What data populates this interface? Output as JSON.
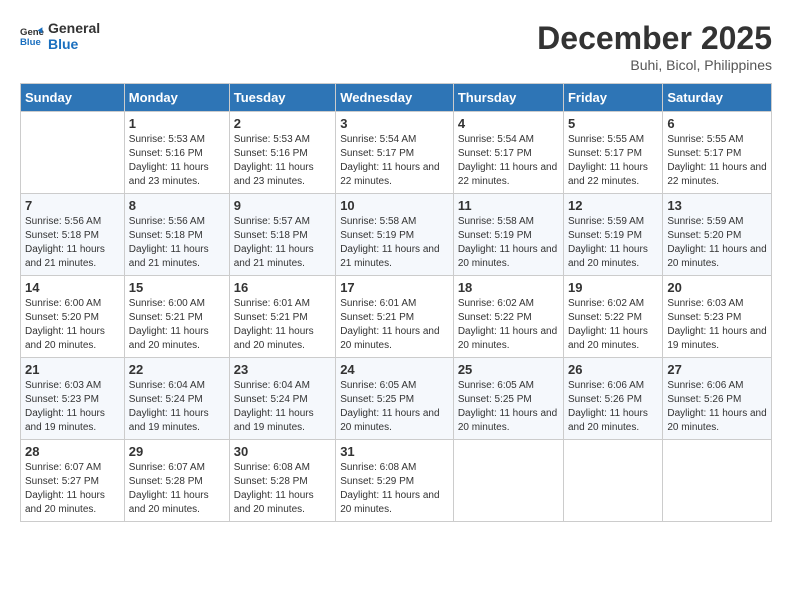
{
  "header": {
    "logo_line1": "General",
    "logo_line2": "Blue",
    "month": "December 2025",
    "location": "Buhi, Bicol, Philippines"
  },
  "weekdays": [
    "Sunday",
    "Monday",
    "Tuesday",
    "Wednesday",
    "Thursday",
    "Friday",
    "Saturday"
  ],
  "weeks": [
    [
      {
        "day": "",
        "sunrise": "",
        "sunset": "",
        "daylight": ""
      },
      {
        "day": "1",
        "sunrise": "Sunrise: 5:53 AM",
        "sunset": "Sunset: 5:16 PM",
        "daylight": "Daylight: 11 hours and 23 minutes."
      },
      {
        "day": "2",
        "sunrise": "Sunrise: 5:53 AM",
        "sunset": "Sunset: 5:16 PM",
        "daylight": "Daylight: 11 hours and 23 minutes."
      },
      {
        "day": "3",
        "sunrise": "Sunrise: 5:54 AM",
        "sunset": "Sunset: 5:17 PM",
        "daylight": "Daylight: 11 hours and 22 minutes."
      },
      {
        "day": "4",
        "sunrise": "Sunrise: 5:54 AM",
        "sunset": "Sunset: 5:17 PM",
        "daylight": "Daylight: 11 hours and 22 minutes."
      },
      {
        "day": "5",
        "sunrise": "Sunrise: 5:55 AM",
        "sunset": "Sunset: 5:17 PM",
        "daylight": "Daylight: 11 hours and 22 minutes."
      },
      {
        "day": "6",
        "sunrise": "Sunrise: 5:55 AM",
        "sunset": "Sunset: 5:17 PM",
        "daylight": "Daylight: 11 hours and 22 minutes."
      }
    ],
    [
      {
        "day": "7",
        "sunrise": "Sunrise: 5:56 AM",
        "sunset": "Sunset: 5:18 PM",
        "daylight": "Daylight: 11 hours and 21 minutes."
      },
      {
        "day": "8",
        "sunrise": "Sunrise: 5:56 AM",
        "sunset": "Sunset: 5:18 PM",
        "daylight": "Daylight: 11 hours and 21 minutes."
      },
      {
        "day": "9",
        "sunrise": "Sunrise: 5:57 AM",
        "sunset": "Sunset: 5:18 PM",
        "daylight": "Daylight: 11 hours and 21 minutes."
      },
      {
        "day": "10",
        "sunrise": "Sunrise: 5:58 AM",
        "sunset": "Sunset: 5:19 PM",
        "daylight": "Daylight: 11 hours and 21 minutes."
      },
      {
        "day": "11",
        "sunrise": "Sunrise: 5:58 AM",
        "sunset": "Sunset: 5:19 PM",
        "daylight": "Daylight: 11 hours and 20 minutes."
      },
      {
        "day": "12",
        "sunrise": "Sunrise: 5:59 AM",
        "sunset": "Sunset: 5:19 PM",
        "daylight": "Daylight: 11 hours and 20 minutes."
      },
      {
        "day": "13",
        "sunrise": "Sunrise: 5:59 AM",
        "sunset": "Sunset: 5:20 PM",
        "daylight": "Daylight: 11 hours and 20 minutes."
      }
    ],
    [
      {
        "day": "14",
        "sunrise": "Sunrise: 6:00 AM",
        "sunset": "Sunset: 5:20 PM",
        "daylight": "Daylight: 11 hours and 20 minutes."
      },
      {
        "day": "15",
        "sunrise": "Sunrise: 6:00 AM",
        "sunset": "Sunset: 5:21 PM",
        "daylight": "Daylight: 11 hours and 20 minutes."
      },
      {
        "day": "16",
        "sunrise": "Sunrise: 6:01 AM",
        "sunset": "Sunset: 5:21 PM",
        "daylight": "Daylight: 11 hours and 20 minutes."
      },
      {
        "day": "17",
        "sunrise": "Sunrise: 6:01 AM",
        "sunset": "Sunset: 5:21 PM",
        "daylight": "Daylight: 11 hours and 20 minutes."
      },
      {
        "day": "18",
        "sunrise": "Sunrise: 6:02 AM",
        "sunset": "Sunset: 5:22 PM",
        "daylight": "Daylight: 11 hours and 20 minutes."
      },
      {
        "day": "19",
        "sunrise": "Sunrise: 6:02 AM",
        "sunset": "Sunset: 5:22 PM",
        "daylight": "Daylight: 11 hours and 20 minutes."
      },
      {
        "day": "20",
        "sunrise": "Sunrise: 6:03 AM",
        "sunset": "Sunset: 5:23 PM",
        "daylight": "Daylight: 11 hours and 19 minutes."
      }
    ],
    [
      {
        "day": "21",
        "sunrise": "Sunrise: 6:03 AM",
        "sunset": "Sunset: 5:23 PM",
        "daylight": "Daylight: 11 hours and 19 minutes."
      },
      {
        "day": "22",
        "sunrise": "Sunrise: 6:04 AM",
        "sunset": "Sunset: 5:24 PM",
        "daylight": "Daylight: 11 hours and 19 minutes."
      },
      {
        "day": "23",
        "sunrise": "Sunrise: 6:04 AM",
        "sunset": "Sunset: 5:24 PM",
        "daylight": "Daylight: 11 hours and 19 minutes."
      },
      {
        "day": "24",
        "sunrise": "Sunrise: 6:05 AM",
        "sunset": "Sunset: 5:25 PM",
        "daylight": "Daylight: 11 hours and 20 minutes."
      },
      {
        "day": "25",
        "sunrise": "Sunrise: 6:05 AM",
        "sunset": "Sunset: 5:25 PM",
        "daylight": "Daylight: 11 hours and 20 minutes."
      },
      {
        "day": "26",
        "sunrise": "Sunrise: 6:06 AM",
        "sunset": "Sunset: 5:26 PM",
        "daylight": "Daylight: 11 hours and 20 minutes."
      },
      {
        "day": "27",
        "sunrise": "Sunrise: 6:06 AM",
        "sunset": "Sunset: 5:26 PM",
        "daylight": "Daylight: 11 hours and 20 minutes."
      }
    ],
    [
      {
        "day": "28",
        "sunrise": "Sunrise: 6:07 AM",
        "sunset": "Sunset: 5:27 PM",
        "daylight": "Daylight: 11 hours and 20 minutes."
      },
      {
        "day": "29",
        "sunrise": "Sunrise: 6:07 AM",
        "sunset": "Sunset: 5:28 PM",
        "daylight": "Daylight: 11 hours and 20 minutes."
      },
      {
        "day": "30",
        "sunrise": "Sunrise: 6:08 AM",
        "sunset": "Sunset: 5:28 PM",
        "daylight": "Daylight: 11 hours and 20 minutes."
      },
      {
        "day": "31",
        "sunrise": "Sunrise: 6:08 AM",
        "sunset": "Sunset: 5:29 PM",
        "daylight": "Daylight: 11 hours and 20 minutes."
      },
      {
        "day": "",
        "sunrise": "",
        "sunset": "",
        "daylight": ""
      },
      {
        "day": "",
        "sunrise": "",
        "sunset": "",
        "daylight": ""
      },
      {
        "day": "",
        "sunrise": "",
        "sunset": "",
        "daylight": ""
      }
    ]
  ]
}
